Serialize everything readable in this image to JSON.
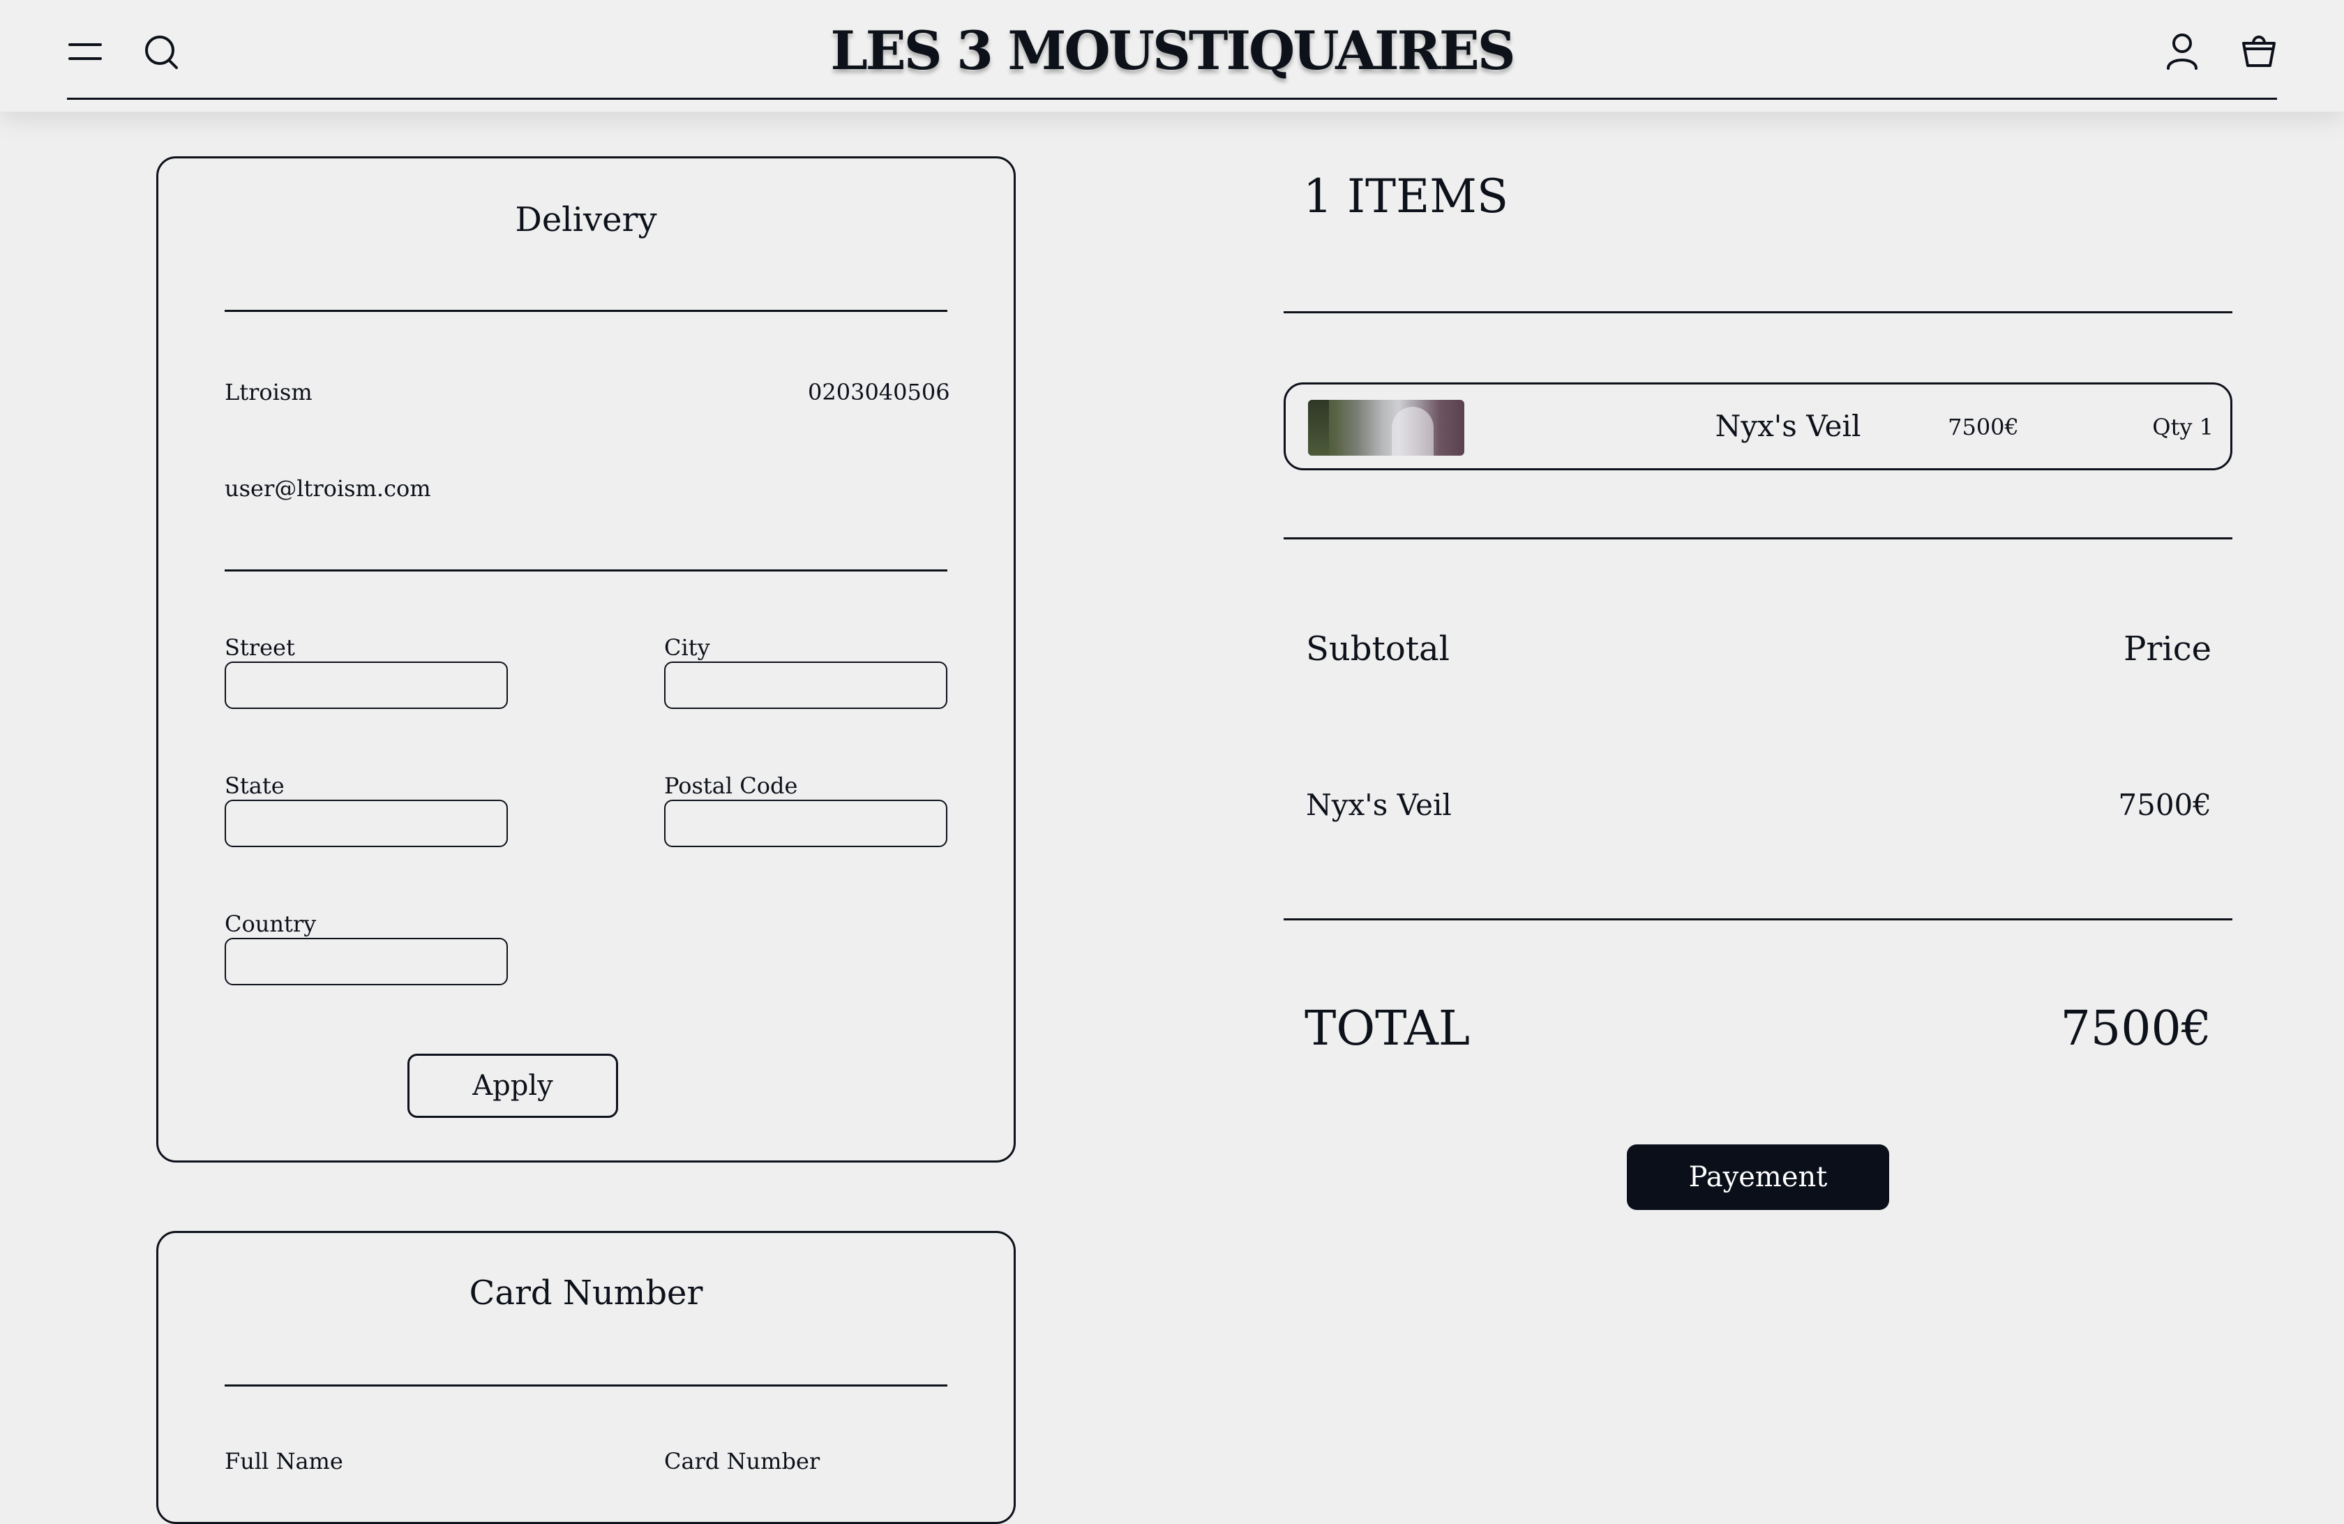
{
  "header": {
    "brand": "LES 3 MOUSTIQUAIRES",
    "icons": [
      "menu-icon",
      "search-icon",
      "account-icon",
      "basket-icon"
    ]
  },
  "delivery": {
    "title": "Delivery",
    "username": "Ltroism",
    "phone": "0203040506",
    "email": "user@ltroism.com",
    "fields": {
      "street": {
        "label": "Street",
        "value": ""
      },
      "city": {
        "label": "City",
        "value": ""
      },
      "state": {
        "label": "State",
        "value": ""
      },
      "postal_code": {
        "label": "Postal Code",
        "value": ""
      },
      "country": {
        "label": "Country",
        "value": ""
      }
    },
    "apply_label": "Apply"
  },
  "card": {
    "title": "Card Number",
    "full_name_label": "Full Name",
    "card_number_label": "Card Number"
  },
  "cart": {
    "items_heading": "1 ITEMS",
    "item": {
      "name": "Nyx's Veil",
      "price": "7500€",
      "qty": "Qty 1"
    },
    "summary": {
      "subtotal_label": "Subtotal",
      "price_label": "Price",
      "line_name": "Nyx's Veil",
      "line_price": "7500€",
      "total_label": "TOTAL",
      "total_value": "7500€"
    },
    "payment_label": "Payement"
  },
  "colors": {
    "background": "#efefef",
    "ink": "#0d111a",
    "button_dark": "#0b0f1a"
  }
}
